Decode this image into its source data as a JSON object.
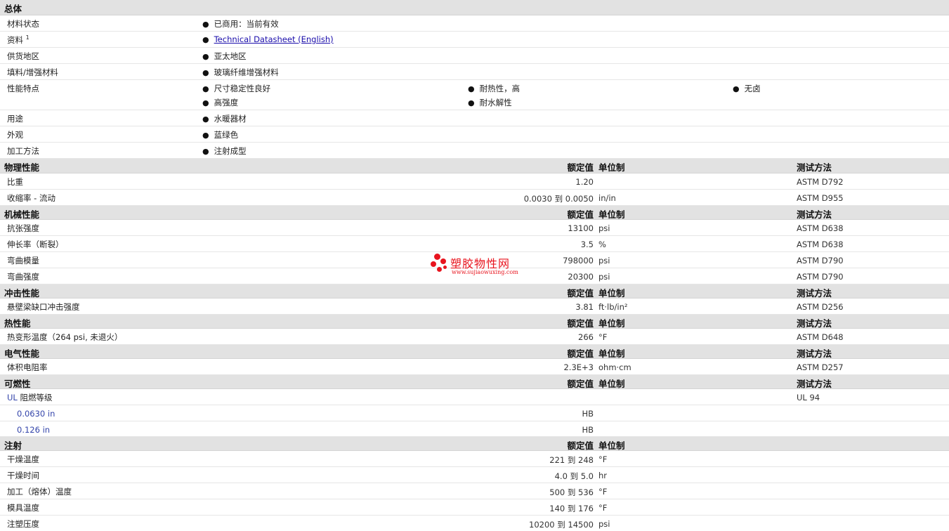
{
  "general": {
    "title": "总体",
    "status_label": "材料状态",
    "status_value": "已商用：当前有效",
    "docs_label": "资料",
    "docs_sup": "1",
    "docs_link": "Technical Datasheet (English)",
    "supply_label": "供货地区",
    "supply_value": "亚太地区",
    "filler_label": "填料/增强材料",
    "filler_value": "玻璃纤维增强材料",
    "features_label": "性能特点",
    "features": [
      "尺寸稳定性良好",
      "耐热性，高",
      "无卤",
      "高强度",
      "耐水解性"
    ],
    "use_label": "用途",
    "use_value": "水暖器材",
    "appearance_label": "外观",
    "appearance_value": "蓝绿色",
    "process_label": "加工方法",
    "process_value": "注射成型"
  },
  "col_headers": {
    "value": "额定值",
    "unit": "单位制",
    "method": "测试方法"
  },
  "physical": {
    "title": "物理性能",
    "rows": [
      {
        "label": "比重",
        "value": "1.20",
        "unit": "",
        "method": "ASTM D792"
      },
      {
        "label": "收缩率  - 流动",
        "value": "0.0030 到  0.0050",
        "unit": "in/in",
        "method": "ASTM D955"
      }
    ]
  },
  "mechanical": {
    "title": "机械性能",
    "rows": [
      {
        "label": "抗张强度",
        "value": "13100",
        "unit": "psi",
        "method": "ASTM D638"
      },
      {
        "label": "伸长率（断裂）",
        "value": "3.5",
        "unit": "%",
        "method": "ASTM D638"
      },
      {
        "label": "弯曲模量",
        "value": "798000",
        "unit": "psi",
        "method": "ASTM D790"
      },
      {
        "label": "弯曲强度",
        "value": "20300",
        "unit": "psi",
        "method": "ASTM D790"
      }
    ]
  },
  "impact": {
    "title": "冲击性能",
    "rows": [
      {
        "label": "悬壁梁缺口冲击强度",
        "value": "3.81",
        "unit": "ft·lb/in²",
        "method": "ASTM D256"
      }
    ]
  },
  "thermal": {
    "title": "热性能",
    "rows": [
      {
        "label": "热变形温度（264 psi, 未退火）",
        "value": "266",
        "unit": "°F",
        "method": "ASTM D648"
      }
    ]
  },
  "electrical": {
    "title": "电气性能",
    "rows": [
      {
        "label": "体积电阻率",
        "value": "2.3E+3",
        "unit": "ohm·cm",
        "method": "ASTM D257"
      }
    ]
  },
  "flammability": {
    "title": "可燃性",
    "ul_prefix": "UL",
    "ul_label": " 阻燃等级",
    "ul_method": "UL 94",
    "rows": [
      {
        "label": "0.0630 in",
        "value": "HB"
      },
      {
        "label": "0.126 in",
        "value": "HB"
      }
    ]
  },
  "injection": {
    "title": "注射",
    "rows": [
      {
        "label": "干燥温度",
        "value": "221 到  248",
        "unit": "°F"
      },
      {
        "label": "干燥时间",
        "value": "4.0 到  5.0",
        "unit": "hr"
      },
      {
        "label": "加工（熔体）温度",
        "value": "500 到  536",
        "unit": "°F"
      },
      {
        "label": "模具温度",
        "value": "140 到  176",
        "unit": "°F"
      },
      {
        "label": "注塑压度",
        "value": "10200 到  14500",
        "unit": "psi"
      }
    ]
  },
  "watermark": {
    "title": "塑胶物性网",
    "url": "www.sujiaowuxing.com",
    "color": "#e8141e"
  }
}
